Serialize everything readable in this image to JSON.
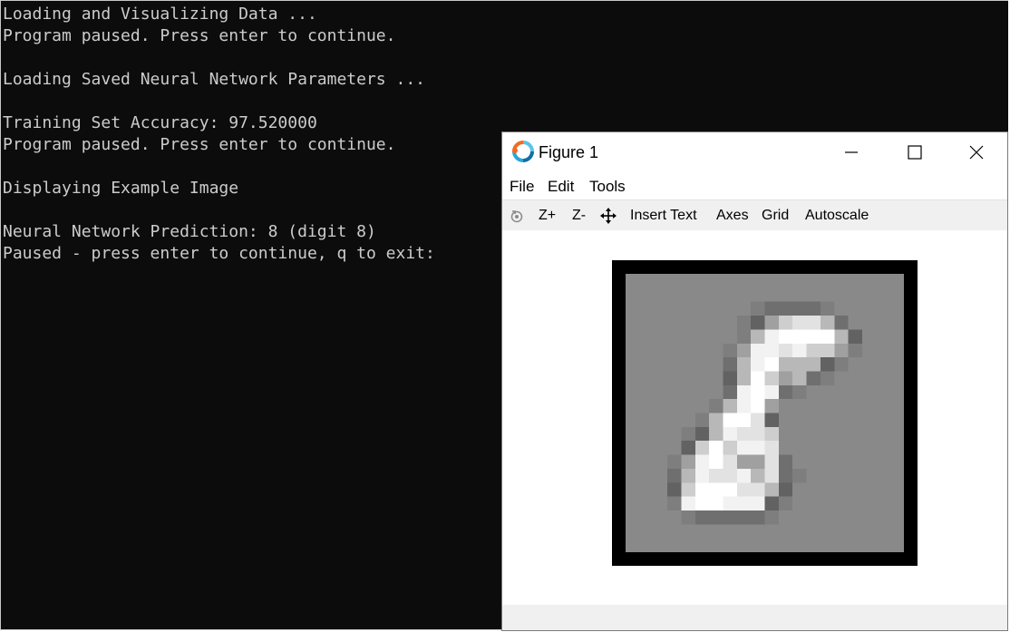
{
  "console": {
    "lines": [
      "Loading and Visualizing Data ...",
      "Program paused. Press enter to continue.",
      "",
      "Loading Saved Neural Network Parameters ...",
      "",
      "Training Set Accuracy: 97.520000",
      "Program paused. Press enter to continue.",
      "",
      "Displaying Example Image",
      "",
      "Neural Network Prediction: 8 (digit 8)",
      "Paused - press enter to continue, q to exit:"
    ]
  },
  "figure": {
    "title": "Figure 1",
    "app_icon": "octave-logo-icon",
    "window_controls": [
      "minimize-icon",
      "maximize-icon",
      "close-icon"
    ],
    "menu": [
      "File",
      "Edit",
      "Tools"
    ],
    "toolbar": {
      "rotate_icon": "rotate-icon",
      "zoom_in": "Z+",
      "zoom_out": "Z-",
      "pan_icon": "pan-icon",
      "insert_text": "Insert Text",
      "axes": "Axes",
      "grid": "Grid",
      "autoscale": "Autoscale"
    },
    "image": {
      "description": "20x20 grayscale handwritten digit",
      "gray_levels_0_to_9": [
        "#898989",
        "#7e7e7e",
        "#6f6f6f",
        "#626262",
        "#a0a0a0",
        "#b8b8b8",
        "#cecece",
        "#e2e2e2",
        "#f2f2f2",
        "#ffffff"
      ],
      "pixels": [
        "00000000000000000000",
        "00000000000000000000",
        "00000000012222100000",
        "00000000134677520000",
        "00000000158999953000",
        "00000001488786641000",
        "00000002589555310000",
        "00000003596452100000",
        "00000002898210000000",
        "00000015894000000000",
        "00000159973000000000",
        "00001358776000000000",
        "00003696887000000000",
        "00014897447200000000",
        "00025877857210000000",
        "00036999775300000000",
        "00018998883100000000",
        "00001222221000000000",
        "00000000000000000000",
        "00000000000000000000"
      ]
    }
  }
}
